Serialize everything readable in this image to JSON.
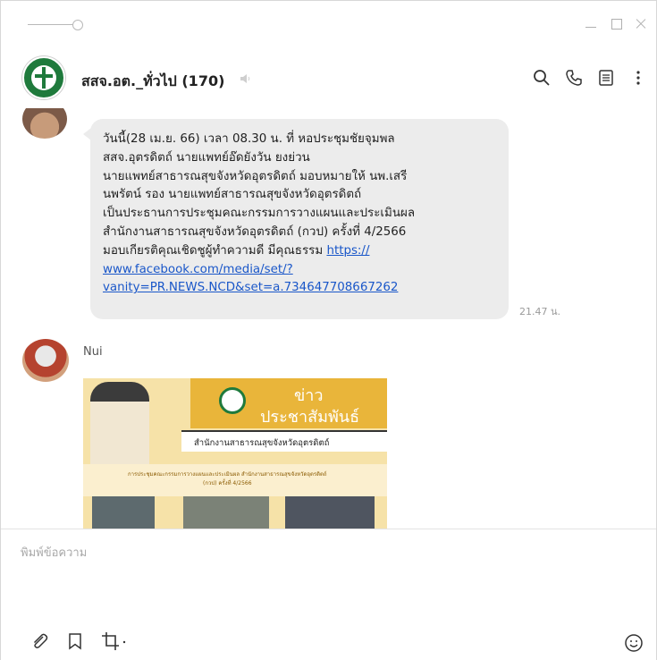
{
  "chat": {
    "title": "สสจ.อต._ทั่วไป (170)",
    "icons": [
      "search-icon",
      "phone-icon",
      "notes-icon",
      "more-vertical-icon"
    ]
  },
  "window": {
    "icons": [
      "minimize-icon",
      "maximize-icon",
      "close-icon"
    ]
  },
  "messages": [
    {
      "text_lines": [
        "วันนี้(28 เม.ย. 66) เวลา 08.30 น. ที่ หอประชุมชัยจุมพล",
        "สสจ.อุตรดิตถ์ นายแพทย์อ๊ดยังวัน ยงย่วน",
        "นายแพทย์สาธารณสุขจังหวัดอุตรดิตถ์ มอบหมายให้ นพ.เสรี",
        "นพรัตน์ รอง นายแพทย์สาธารณสุขจังหวัดอุตรดิตถ์",
        "เป็นประธานการประชุมคณะกรรมการวางแผนและประเมินผล",
        "สำนักงานสาธารณสุขจังหวัดอุตรดิตถ์ (กวป) ครั้งที่ 4/2566",
        "มอบเกียรติคุณเชิดชูผู้ทำความดี มีคุณธรรม"
      ],
      "link_lines": [
        "https://",
        "www.facebook.com/media/set/?",
        "vanity=PR.NEWS.NCD&set=a.734647708667262"
      ],
      "time": "21.47 น."
    },
    {
      "sender": "Nui",
      "image": {
        "headline_1": "ข่าว",
        "headline_2": "ประชาสัมพันธ์",
        "office": "สำนักงานสาธารณสุขจังหวัดอุตรดิตถ์",
        "caption_1": "การประชุมคณะกรรมการวางแผนและประเมินผล สำนักงานสาธารณสุขจังหวัดอุตรดิตถ์",
        "caption_2": "(กวป) ครั้งที่ 4/2566"
      }
    }
  ],
  "composer": {
    "placeholder": "พิมพ์ข้อความ",
    "tools": [
      "attach-icon",
      "bookmark-icon",
      "crop-icon"
    ],
    "emoji": "emoji-icon"
  },
  "colors": {
    "bubble": "#ececec",
    "link": "#1a57c9",
    "brand_green": "#1f7a3c",
    "banner": "#e9b53a"
  }
}
